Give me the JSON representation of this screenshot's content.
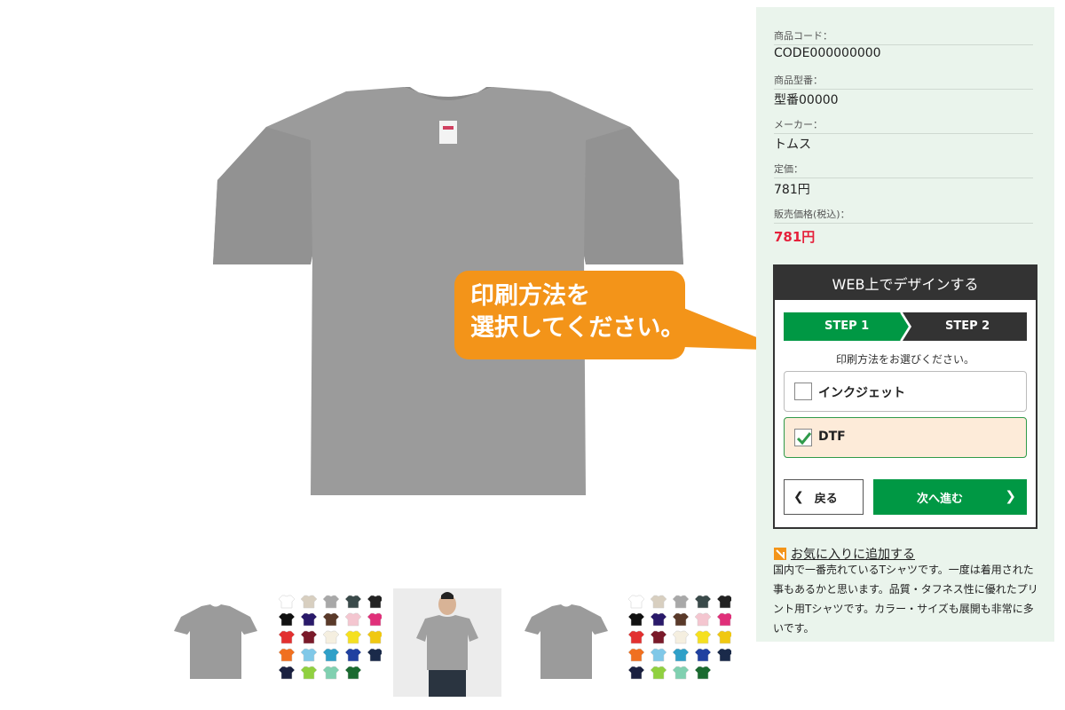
{
  "product_info": {
    "code_label": "商品コード：",
    "code_value": "CODE000000000",
    "model_label": "商品型番：",
    "model_value": "型番00000",
    "maker_label": "メーカー：",
    "maker_value": "トムス",
    "list_price_label": "定価：",
    "list_price_value": "781円",
    "sale_price_label": "販売価格(税込)：",
    "sale_price_value": "781円"
  },
  "design": {
    "header": "WEB上でデザインする",
    "steps": [
      "STEP 1",
      "STEP 2"
    ],
    "instruction": "印刷方法をお選びください。",
    "options": [
      {
        "label": "インクジェット",
        "selected": false
      },
      {
        "label": "DTF",
        "selected": true
      }
    ],
    "back_label": "戻る",
    "next_label": "次へ進む"
  },
  "callout": {
    "text": "印刷方法を\n選択してください。"
  },
  "favorite_link": "お気に入りに追加する",
  "description": "国内で一番売れているTシャツです。一度は着用された事もあるかと思います。品質・タフネス性に優れたプリント用Tシャツです。カラー・サイズも展開も非常に多いです。",
  "colors": {
    "accent_green": "#009844",
    "callout_orange": "#f39419",
    "price_red": "#e5213b",
    "panel_bg": "#eaf4ec",
    "shirt_gray": "#9a9a9a"
  },
  "swatch_colors": [
    "#ffffff",
    "#d8cfc0",
    "#a8a8a8",
    "#3a4a4a",
    "#222222",
    "#111111",
    "#2a1a6a",
    "#5a3a2a",
    "#f4c6d0",
    "#e0307a",
    "#e23030",
    "#7a1a2a",
    "#f5efe0",
    "#f5e020",
    "#f0c810",
    "#f07020",
    "#80c8e8",
    "#30a0c8",
    "#2040a0",
    "#1a2a4a",
    "#1a2040",
    "#90d040",
    "#80d0b0",
    "#1a6a30"
  ]
}
